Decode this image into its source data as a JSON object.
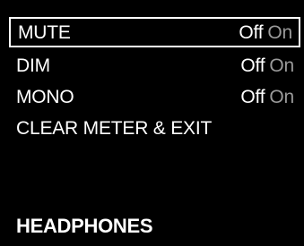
{
  "menu": {
    "items": [
      {
        "label": "MUTE",
        "off_label": "Off",
        "on_label": "On",
        "value": "Off",
        "selected": true
      },
      {
        "label": "DIM",
        "off_label": "Off",
        "on_label": "On",
        "value": "Off",
        "selected": false
      },
      {
        "label": "MONO",
        "off_label": "Off",
        "on_label": "On",
        "value": "Off",
        "selected": false
      },
      {
        "label": "CLEAR METER & EXIT",
        "selected": false
      }
    ]
  },
  "footer": {
    "title": "HEADPHONES"
  },
  "colors": {
    "background": "#000000",
    "text": "#ffffff",
    "inactive_option": "#9a9a9a",
    "selection_border": "#ffffff"
  }
}
